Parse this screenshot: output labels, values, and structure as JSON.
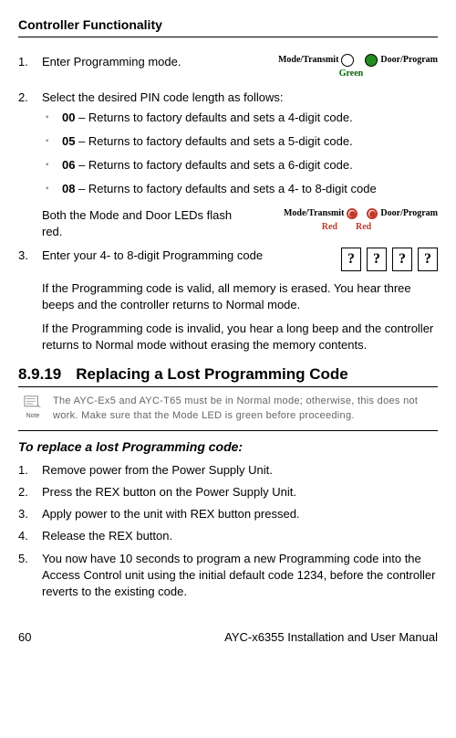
{
  "header": "Controller Functionality",
  "step1_text": "Enter Programming mode.",
  "diagram1": {
    "mode_label": "Mode/Transmit",
    "door_label": "Door/Program",
    "color_label": "Green"
  },
  "step2_intro": "Select the desired PIN code length as follows:",
  "pin_options": [
    {
      "code": "00",
      "desc": " – Returns to factory defaults and sets a 4-digit code."
    },
    {
      "code": "05",
      "desc": " – Returns to factory defaults and sets a 5-digit code."
    },
    {
      "code": "06",
      "desc": " – Returns to factory defaults and sets a 6-digit code."
    },
    {
      "code": "08",
      "desc": " – Returns to factory defaults and sets a 4- to 8-digit code"
    }
  ],
  "both_leds_text": "Both the Mode and Door LEDs flash red.",
  "diagram2": {
    "mode_label": "Mode/Transmit",
    "door_label": "Door/Program",
    "red1": "Red",
    "red2": "Red"
  },
  "step3_text": "Enter your 4- to 8-digit Programming code",
  "code_placeholder": "?",
  "valid_text": "If the Programming code is valid, all memory is erased. You hear three beeps and the controller returns to Normal mode.",
  "invalid_text": "If the Programming code is invalid, you hear a long beep and the controller returns to Normal mode without erasing the memory contents.",
  "section_number": "8.9.19",
  "section_title": "Replacing a Lost Programming Code",
  "note_text": "The AYC-Ex5 and AYC-T65 must be in Normal mode; otherwise, this does not work. Make sure that the Mode LED is green before proceeding.",
  "note_label": "Note",
  "subheading": "To replace a lost Programming code:",
  "replace_steps": {
    "s1": "Remove power from the Power Supply Unit.",
    "s2": "Press the REX button on the Power Supply Unit.",
    "s3": "Apply power to the unit with REX button pressed.",
    "s4": "Release the REX button.",
    "s5": "You now have 10 seconds to program a new Programming code into the Access Control unit using the initial default code 1234, before the controller reverts to the existing code."
  },
  "footer_page": "60",
  "footer_doc": "AYC-x6355 Installation and User Manual"
}
